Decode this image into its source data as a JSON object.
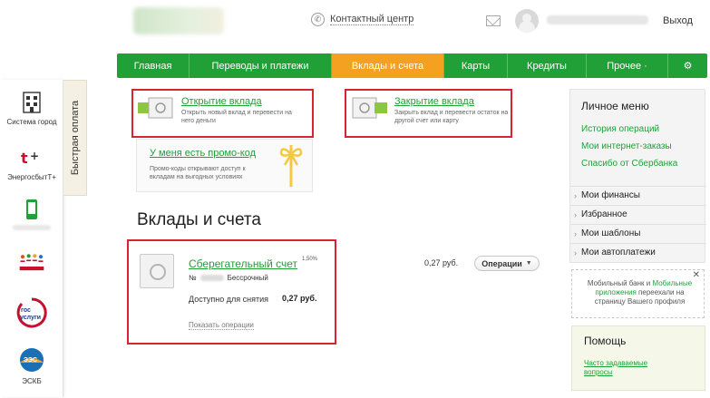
{
  "header": {
    "contact_label": "Контактный центр",
    "logout_label": "Выход"
  },
  "nav": [
    {
      "label": "Главная",
      "width": 80
    },
    {
      "label": "Переводы и платежи",
      "width": 157
    },
    {
      "label": "Вклады и счета",
      "width": 124,
      "active": true
    },
    {
      "label": "Карты",
      "width": 70
    },
    {
      "label": "Кредиты",
      "width": 87
    },
    {
      "label": "Прочее ·",
      "width": 90
    },
    {
      "label": "⚙",
      "width": 43
    }
  ],
  "quick_pay": {
    "tab_label": "Быстрая оплата",
    "items": [
      {
        "label": "Система город",
        "icon": "city-icon"
      },
      {
        "label": "ЭнергосбытТ+",
        "icon": "energy-icon"
      },
      {
        "label": "",
        "icon": "mobile-icon"
      },
      {
        "label": "",
        "icon": "charity-icon"
      },
      {
        "label": "",
        "icon": "gosuslugi-icon"
      },
      {
        "label": "ЭСКБ",
        "icon": "eskb-icon"
      }
    ]
  },
  "open_deposit": {
    "title": "Открытие вклада",
    "desc": "Открыть новый вклад и перевести на него деньги"
  },
  "close_deposit": {
    "title": "Закрытие вклада",
    "desc": "Закрыть вклад и перевести остаток на другой счет или карту"
  },
  "promo": {
    "title": "У меня есть промо-код",
    "desc": "Промо-коды открывают доступ к вкладам на выгодных условиях"
  },
  "page_title": "Вклады и счета",
  "account": {
    "title": "Сберегательный счет",
    "rate": "1,50%",
    "number_prefix": "№",
    "term": "Бессрочный",
    "available_label": "Доступно для снятия",
    "available_amount": "0,27 руб.",
    "show_ops": "Показать операции",
    "balance": "0,27 руб.",
    "ops_button": "Операции"
  },
  "right_panel": {
    "title": "Личное меню",
    "links": [
      "История операций",
      "Мои интернет-заказы",
      "Спасибо от Сбербанка"
    ],
    "menu": [
      "Мои финансы",
      "Избранное",
      "Мои шаблоны",
      "Мои автоплатежи"
    ]
  },
  "notice": {
    "prefix": "Мобильный банк и ",
    "link": "Мобильные приложения",
    "suffix": " переехали на страницу Вашего профиля"
  },
  "help": {
    "title": "Помощь",
    "link": "Часто задаваемые вопросы"
  },
  "colors": {
    "brand_green": "#21a038",
    "active_orange": "#f4a020",
    "highlight_red": "#d9232d"
  }
}
